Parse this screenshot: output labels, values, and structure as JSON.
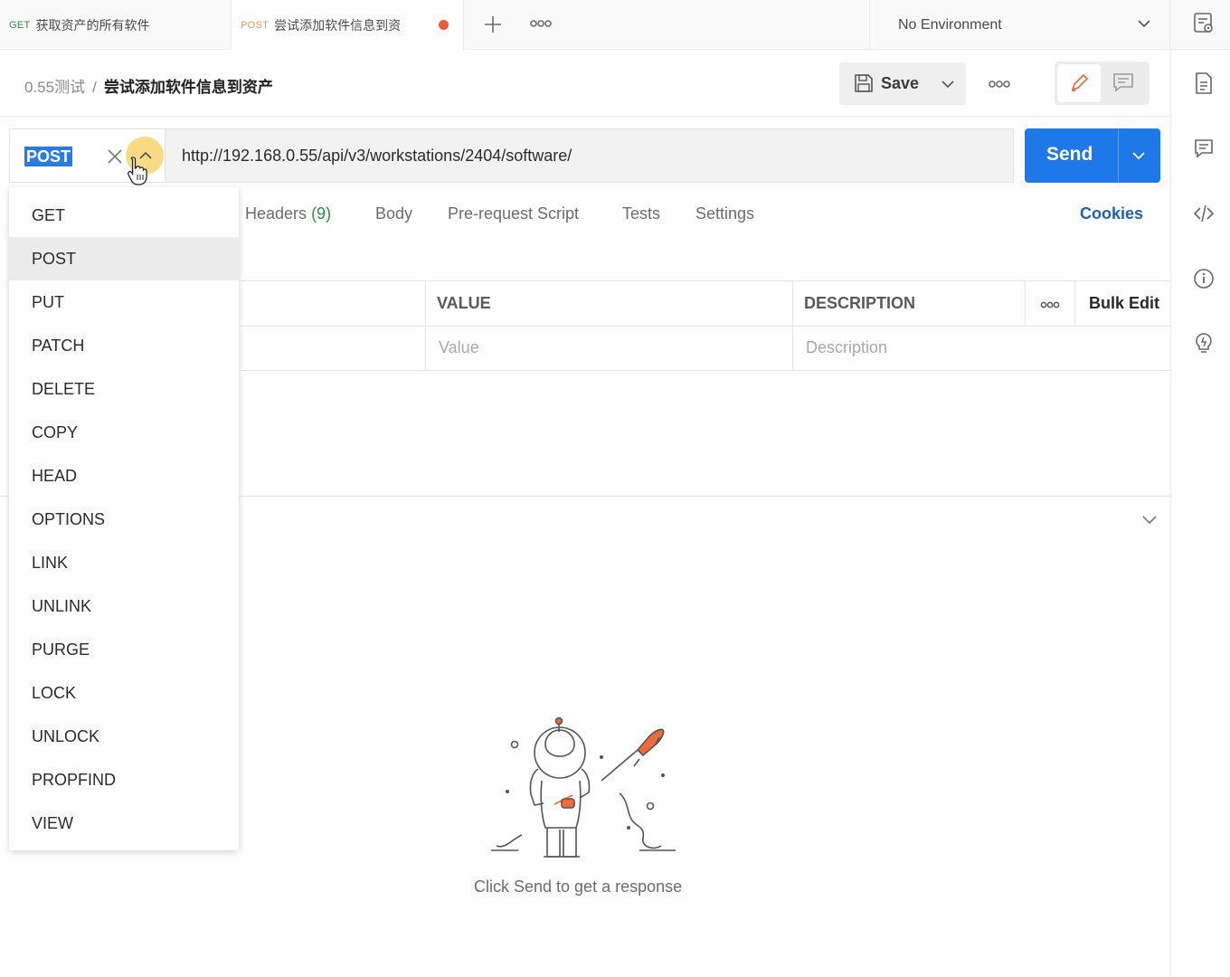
{
  "tabs": [
    {
      "method": "GET",
      "title": "获取资产的所有软件"
    },
    {
      "method": "POST",
      "title": "尝试添加软件信息到资",
      "unsaved": true
    }
  ],
  "environment": {
    "selected": "No Environment"
  },
  "breadcrumb": {
    "collection": "0.55测试",
    "separator": "/",
    "request": "尝试添加软件信息到资产"
  },
  "toolbar": {
    "save_label": "Save"
  },
  "request": {
    "method": "POST",
    "url": "http://192.168.0.55/api/v3/workstations/2404/software/",
    "send_label": "Send"
  },
  "request_tabs": {
    "headers_label": "Headers",
    "headers_count": "(9)",
    "body": "Body",
    "prerequest": "Pre-request Script",
    "tests": "Tests",
    "settings": "Settings",
    "cookies": "Cookies"
  },
  "params_table": {
    "columns": {
      "value": "VALUE",
      "description": "DESCRIPTION"
    },
    "bulk_edit": "Bulk Edit",
    "placeholder_value": "Value",
    "placeholder_description": "Description"
  },
  "response": {
    "empty_message": "Click Send to get a response"
  },
  "method_menu": {
    "items": [
      "GET",
      "POST",
      "PUT",
      "PATCH",
      "DELETE",
      "COPY",
      "HEAD",
      "OPTIONS",
      "LINK",
      "UNLINK",
      "PURGE",
      "LOCK",
      "UNLOCK",
      "PROPFIND",
      "VIEW"
    ],
    "selected": "POST"
  },
  "colors": {
    "accent": "#1f78e8",
    "get": "#2e8c4a",
    "post": "#e69a4a",
    "unsaved_dot": "#ee5a3a",
    "link": "#1f5fb8"
  }
}
